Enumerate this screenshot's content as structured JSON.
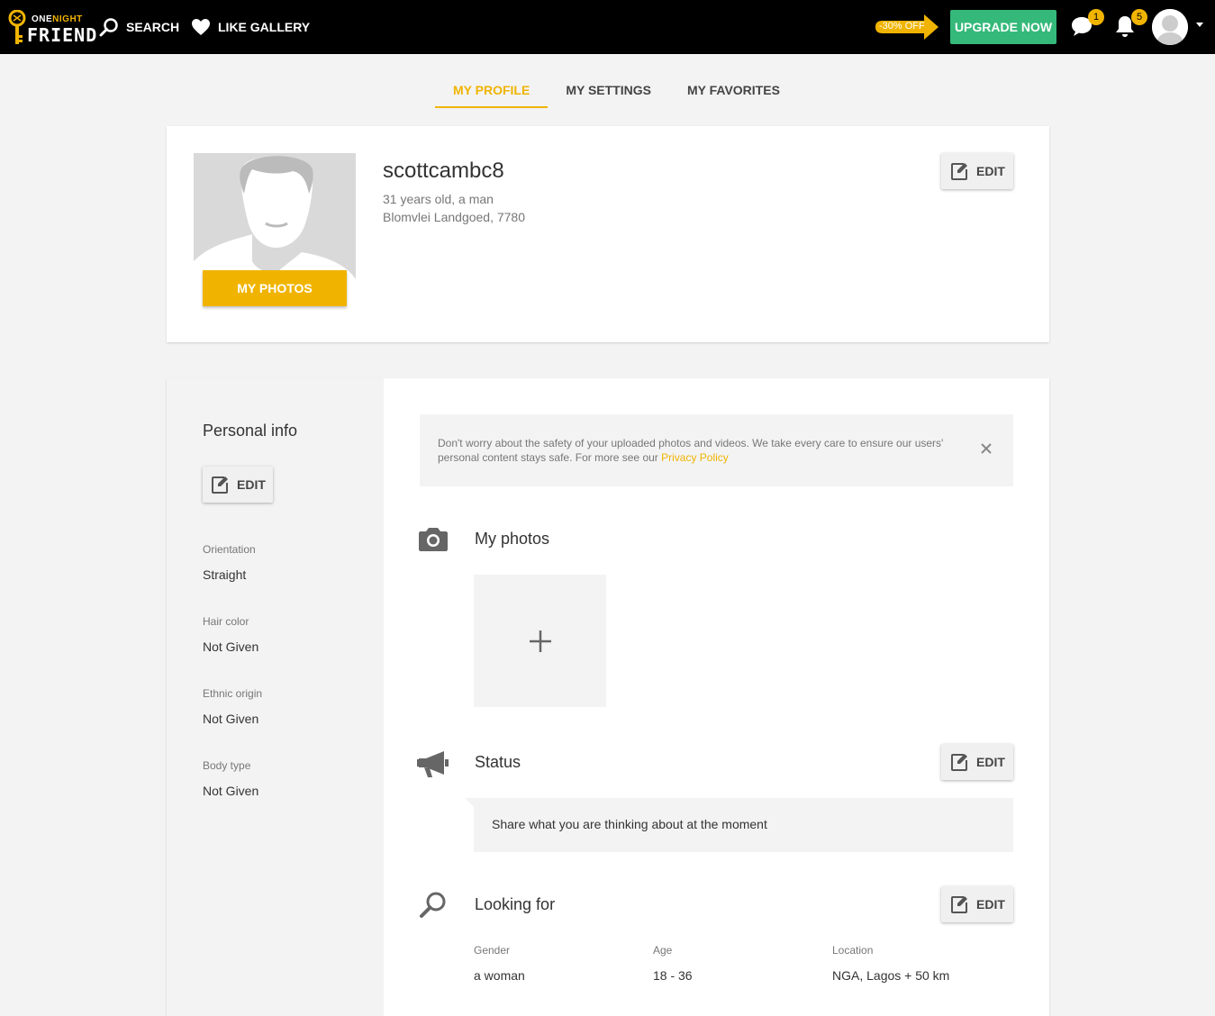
{
  "brand": {
    "logo_top": "ONE",
    "logo_top_accent": "NIGHT",
    "logo_bottom": "FRIEND"
  },
  "nav": {
    "search_label": "SEARCH",
    "gallery_label": "LIKE GALLERY"
  },
  "promo": {
    "discount": "-30% OFF",
    "upgrade_label": "UPGRADE NOW"
  },
  "notifications": {
    "messages_count": "1",
    "alerts_count": "5"
  },
  "tabs": [
    {
      "label": "MY PROFILE",
      "active": true
    },
    {
      "label": "MY SETTINGS",
      "active": false
    },
    {
      "label": "MY FAVORITES",
      "active": false
    }
  ],
  "profile": {
    "username": "scottcambc8",
    "age_gender": "31 years old, a man",
    "location": "Blomvlei Landgoed, 7780",
    "photos_button": "MY PHOTOS",
    "edit_label": "EDIT"
  },
  "personal_info": {
    "title": "Personal info",
    "edit_label": "EDIT",
    "fields": [
      {
        "label": "Orientation",
        "value": "Straight"
      },
      {
        "label": "Hair color",
        "value": "Not Given"
      },
      {
        "label": "Ethnic origin",
        "value": "Not Given"
      },
      {
        "label": "Body type",
        "value": "Not Given"
      }
    ]
  },
  "notice": {
    "text": "Don't worry about the safety of your uploaded photos and videos. We take every care to ensure our users' personal content stays safe. For more see our ",
    "link": "Privacy Policy"
  },
  "photos_section": {
    "title": "My photos"
  },
  "status_section": {
    "title": "Status",
    "edit_label": "EDIT",
    "placeholder": "Share what you are thinking about at the moment"
  },
  "looking_for": {
    "title": "Looking for",
    "edit_label": "EDIT",
    "columns": [
      {
        "label": "Gender",
        "value": "a woman"
      },
      {
        "label": "Age",
        "value": "18 - 36"
      },
      {
        "label": "Location",
        "value": "NGA, Lagos + 50 km"
      }
    ]
  },
  "colors": {
    "accent": "#f0b400",
    "upgrade": "#35b97a",
    "topbar": "#000000",
    "background": "#f3f3f3"
  }
}
